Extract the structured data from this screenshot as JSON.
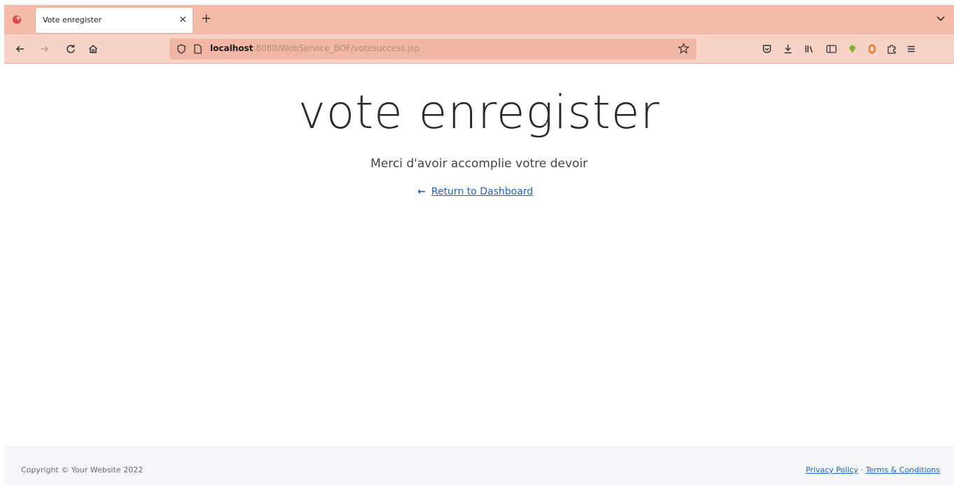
{
  "browser": {
    "tab": {
      "title": "Vote enregister",
      "close": "×"
    },
    "new_tab": "+",
    "url": {
      "host": "localhost",
      "path": ":8080/WebService_BOF/votesuccess.jsp"
    }
  },
  "page": {
    "heading": "vote enregister",
    "subtitle": "Merci d'avoir accomplie votre devoir",
    "back_arrow": "←",
    "back_link": "Return to Dashboard"
  },
  "footer": {
    "copyright": "Copyright © Your Website 2022",
    "privacy": "Privacy Policy",
    "separator": "·",
    "terms": "Terms & Conditions"
  },
  "colors": {
    "tabstrip": "#f4bba8",
    "toolbar": "#f7d2c6",
    "link": "#2164c9"
  }
}
